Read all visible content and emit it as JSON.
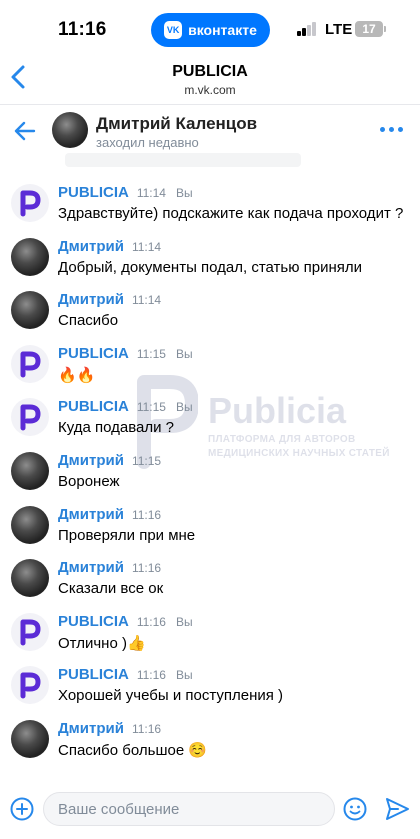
{
  "status_bar": {
    "time": "11:16",
    "pill_label": "вконтакте",
    "pill_logo": "VK",
    "network": "LTE",
    "battery": "17",
    "colors": {
      "pill": "#0077ff"
    }
  },
  "browser": {
    "title": "PUBLICIA",
    "url": "m.vk.com"
  },
  "chat_header": {
    "name": "Дмитрий Каленцов",
    "status": "заходил недавно"
  },
  "watermark": {
    "title": "Publicia",
    "line1": "ПЛАТФОРМА ДЛЯ АВТОРОВ",
    "line2": "МЕДИЦИНСКИХ НАУЧНЫХ СТАТЕЙ"
  },
  "messages": [
    {
      "author": "PUBLICIA",
      "time": "11:14",
      "you": "Вы",
      "text": "Здравствуйте) подскажите как подача проходит ?",
      "avatar": "publicia-logo"
    },
    {
      "author": "Дмитрий",
      "time": "11:14",
      "you": "",
      "text": "Добрый, документы подал, статью приняли",
      "avatar": "user-photo"
    },
    {
      "author": "Дмитрий",
      "time": "11:14",
      "you": "",
      "text": "Спасибо",
      "avatar": "user-photo"
    },
    {
      "author": "PUBLICIA",
      "time": "11:15",
      "you": "Вы",
      "text": "🔥🔥",
      "avatar": "publicia-logo"
    },
    {
      "author": "PUBLICIA",
      "time": "11:15",
      "you": "Вы",
      "text": "Куда подавали ?",
      "avatar": "publicia-logo"
    },
    {
      "author": "Дмитрий",
      "time": "11:15",
      "you": "",
      "text": "Воронеж",
      "avatar": "user-photo"
    },
    {
      "author": "Дмитрий",
      "time": "11:16",
      "you": "",
      "text": "Проверяли при мне",
      "avatar": "user-photo"
    },
    {
      "author": "Дмитрий",
      "time": "11:16",
      "you": "",
      "text": "Сказали все ок",
      "avatar": "user-photo"
    },
    {
      "author": "PUBLICIA",
      "time": "11:16",
      "you": "Вы",
      "text": "Отлично )👍",
      "avatar": "publicia-logo"
    },
    {
      "author": "PUBLICIA",
      "time": "11:16",
      "you": "Вы",
      "text": "Хорошей учебы и поступления )",
      "avatar": "publicia-logo"
    },
    {
      "author": "Дмитрий",
      "time": "11:16",
      "you": "",
      "text": "Спасибо большое ☺️",
      "avatar": "user-photo"
    }
  ],
  "composer": {
    "placeholder": "Ваше сообщение",
    "value": ""
  },
  "colors": {
    "accent": "#2688eb",
    "author": "#2a82d8",
    "meta": "#818c99",
    "publicia_brand": "#5b2bd6"
  },
  "icons": {
    "browser_back": "chevron-left-icon",
    "chat_back": "arrow-left-icon",
    "more": "more-dots-icon",
    "attach": "plus-circle-icon",
    "emoji": "smile-icon",
    "send": "send-icon"
  }
}
